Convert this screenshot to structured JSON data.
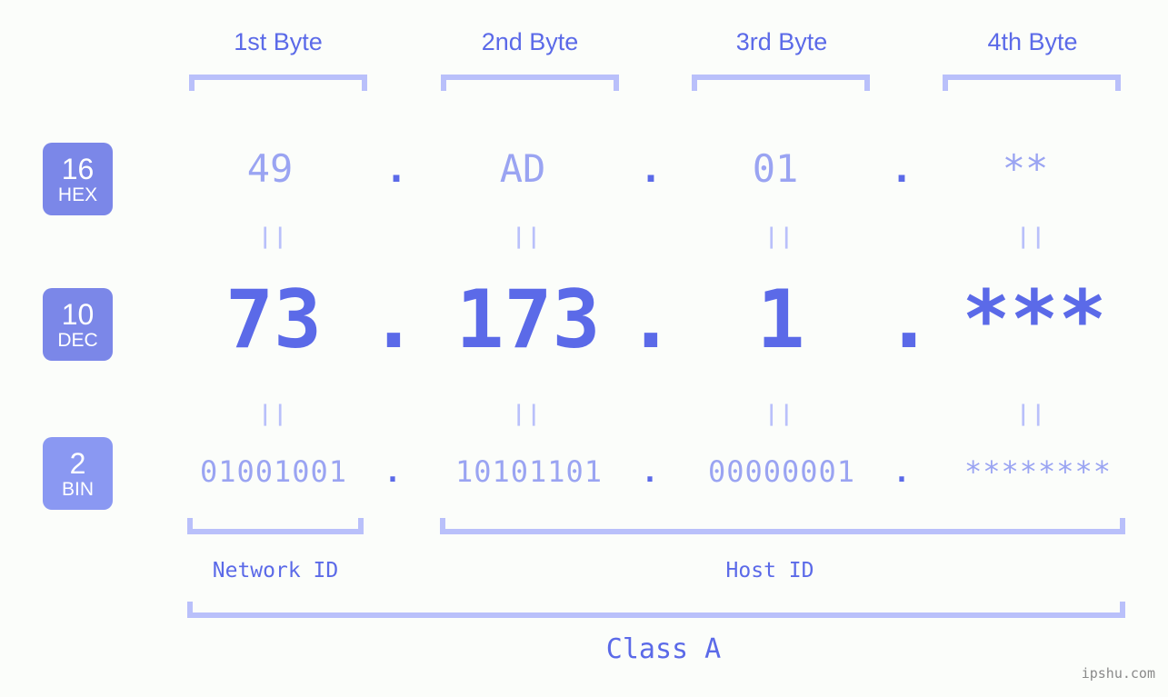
{
  "meta": {
    "watermark": "ipshu.com",
    "background_color": "#fbfdfa",
    "accent_strong": "#5b6ae8",
    "accent_light": "#9aa4f2",
    "accent_bracket": "#b9c0fa",
    "badge_color": "#7b87e8"
  },
  "byte_headers": [
    {
      "label": "1st Byte"
    },
    {
      "label": "2nd Byte"
    },
    {
      "label": "3rd Byte"
    },
    {
      "label": "4th Byte"
    }
  ],
  "bases": [
    {
      "num": "16",
      "abbr": "HEX"
    },
    {
      "num": "10",
      "abbr": "DEC"
    },
    {
      "num": "2",
      "abbr": "BIN"
    }
  ],
  "rows": {
    "hex": {
      "base_num": "16",
      "base_abbr": "HEX",
      "values": [
        "49",
        "AD",
        "01",
        "**"
      ],
      "separator": "."
    },
    "dec": {
      "base_num": "10",
      "base_abbr": "DEC",
      "values": [
        "73",
        "173",
        "1",
        "***"
      ],
      "separator": "."
    },
    "bin": {
      "base_num": "2",
      "base_abbr": "BIN",
      "values": [
        "01001001",
        "10101101",
        "00000001",
        "********"
      ],
      "separator": "."
    }
  },
  "equality_marks": {
    "glyph": "||",
    "count_per_row": 4
  },
  "captions": {
    "network_id": "Network ID",
    "host_id": "Host ID",
    "class": "Class A"
  }
}
